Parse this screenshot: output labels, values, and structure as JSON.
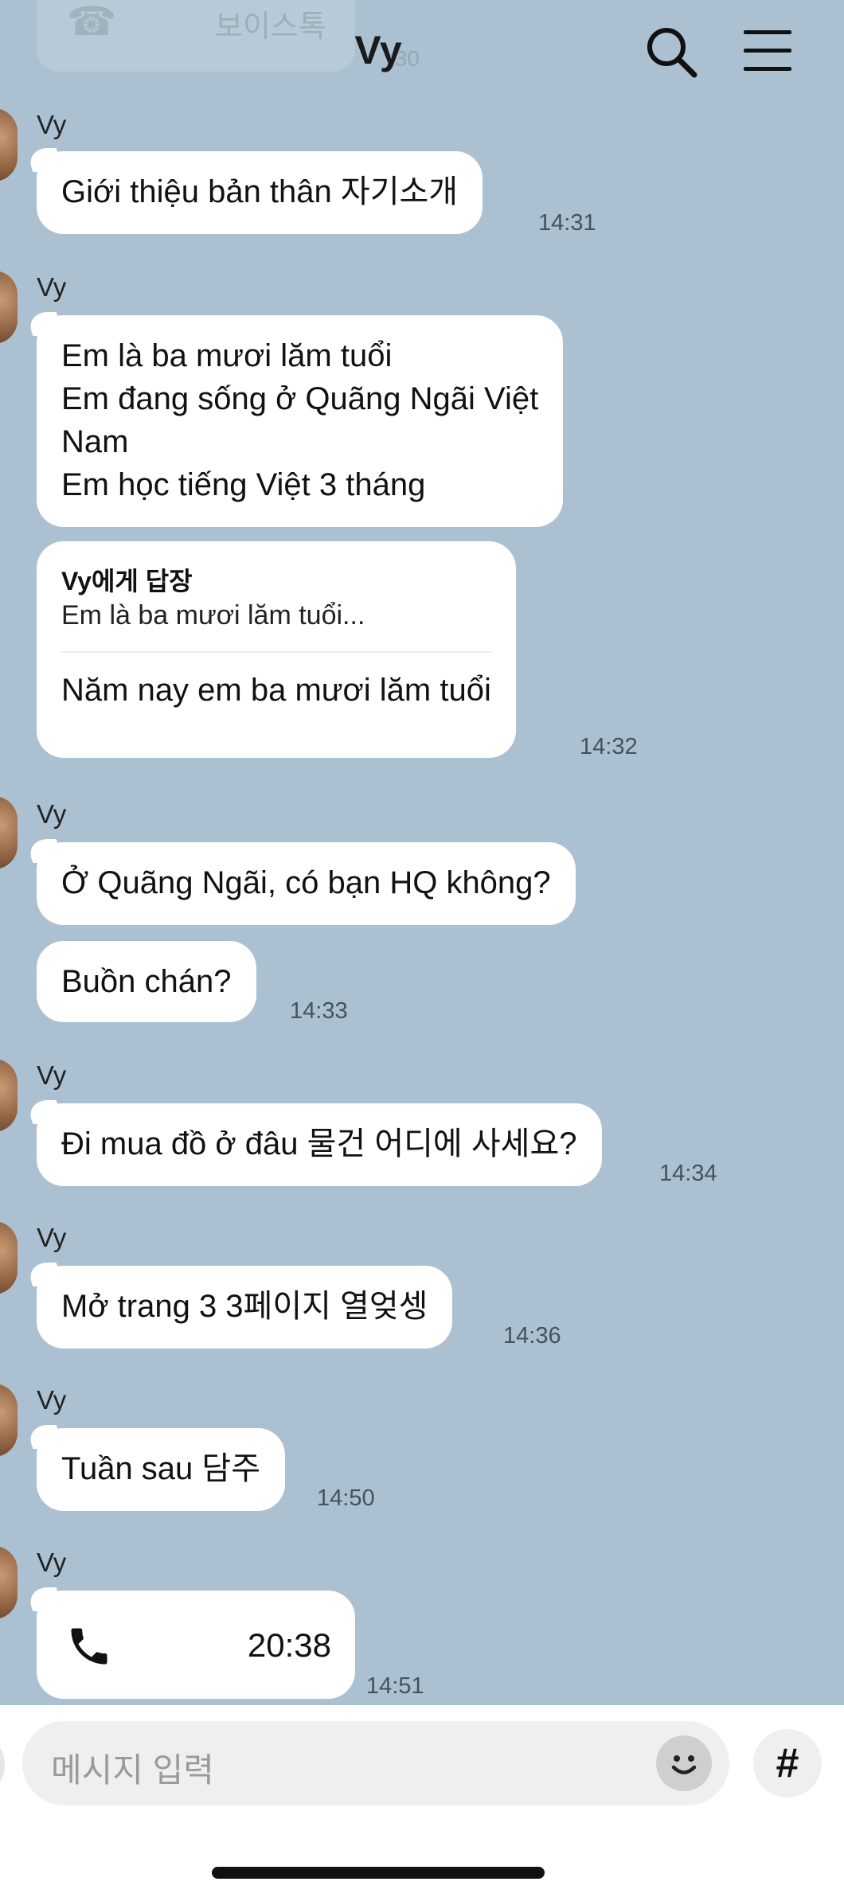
{
  "header": {
    "title": "Vy",
    "search_icon": "search-icon",
    "menu_icon": "hamburger-menu-icon",
    "ghost_message": {
      "label": "보이스톡",
      "time": ":30"
    }
  },
  "messages": [
    {
      "sender": "Vy",
      "text": "Giới thiệu bản thân 자기소개",
      "time": "14:31"
    },
    {
      "sender": "Vy",
      "lines": [
        "Em là ba mươi lăm tuổi",
        "Em đang sống ở Quãng Ngãi Việt",
        "Nam",
        "Em học tiếng Việt 3 tháng"
      ]
    },
    {
      "reply": {
        "header": "Vy에게 답장",
        "quote": "Em là ba mươi lăm tuổi...",
        "text": "Năm nay em ba mươi lăm tuổi"
      },
      "time": "14:32"
    },
    {
      "sender": "Vy",
      "text": "Ở Quãng Ngãi, có bạn HQ không?"
    },
    {
      "text": "Buồn chán?",
      "time": "14:33"
    },
    {
      "sender": "Vy",
      "text": "Đi mua đồ ở đâu 물건 어디에 사세요?",
      "time": "14:34"
    },
    {
      "sender": "Vy",
      "text": "Mở trang 3 3페이지 열엊셍",
      "time": "14:36"
    },
    {
      "sender": "Vy",
      "text": "Tuần sau 담주",
      "time": "14:50"
    },
    {
      "sender": "Vy",
      "call": {
        "icon": "phone-icon",
        "duration": "20:38"
      },
      "time": "14:51"
    }
  ],
  "input": {
    "placeholder": "메시지 입력",
    "emoji_icon": "emoji-smile-icon",
    "hash_label": "#"
  },
  "colors": {
    "chat_background": "#abc1d1",
    "bubble": "#ffffff",
    "input_bar": "#ffffff"
  }
}
